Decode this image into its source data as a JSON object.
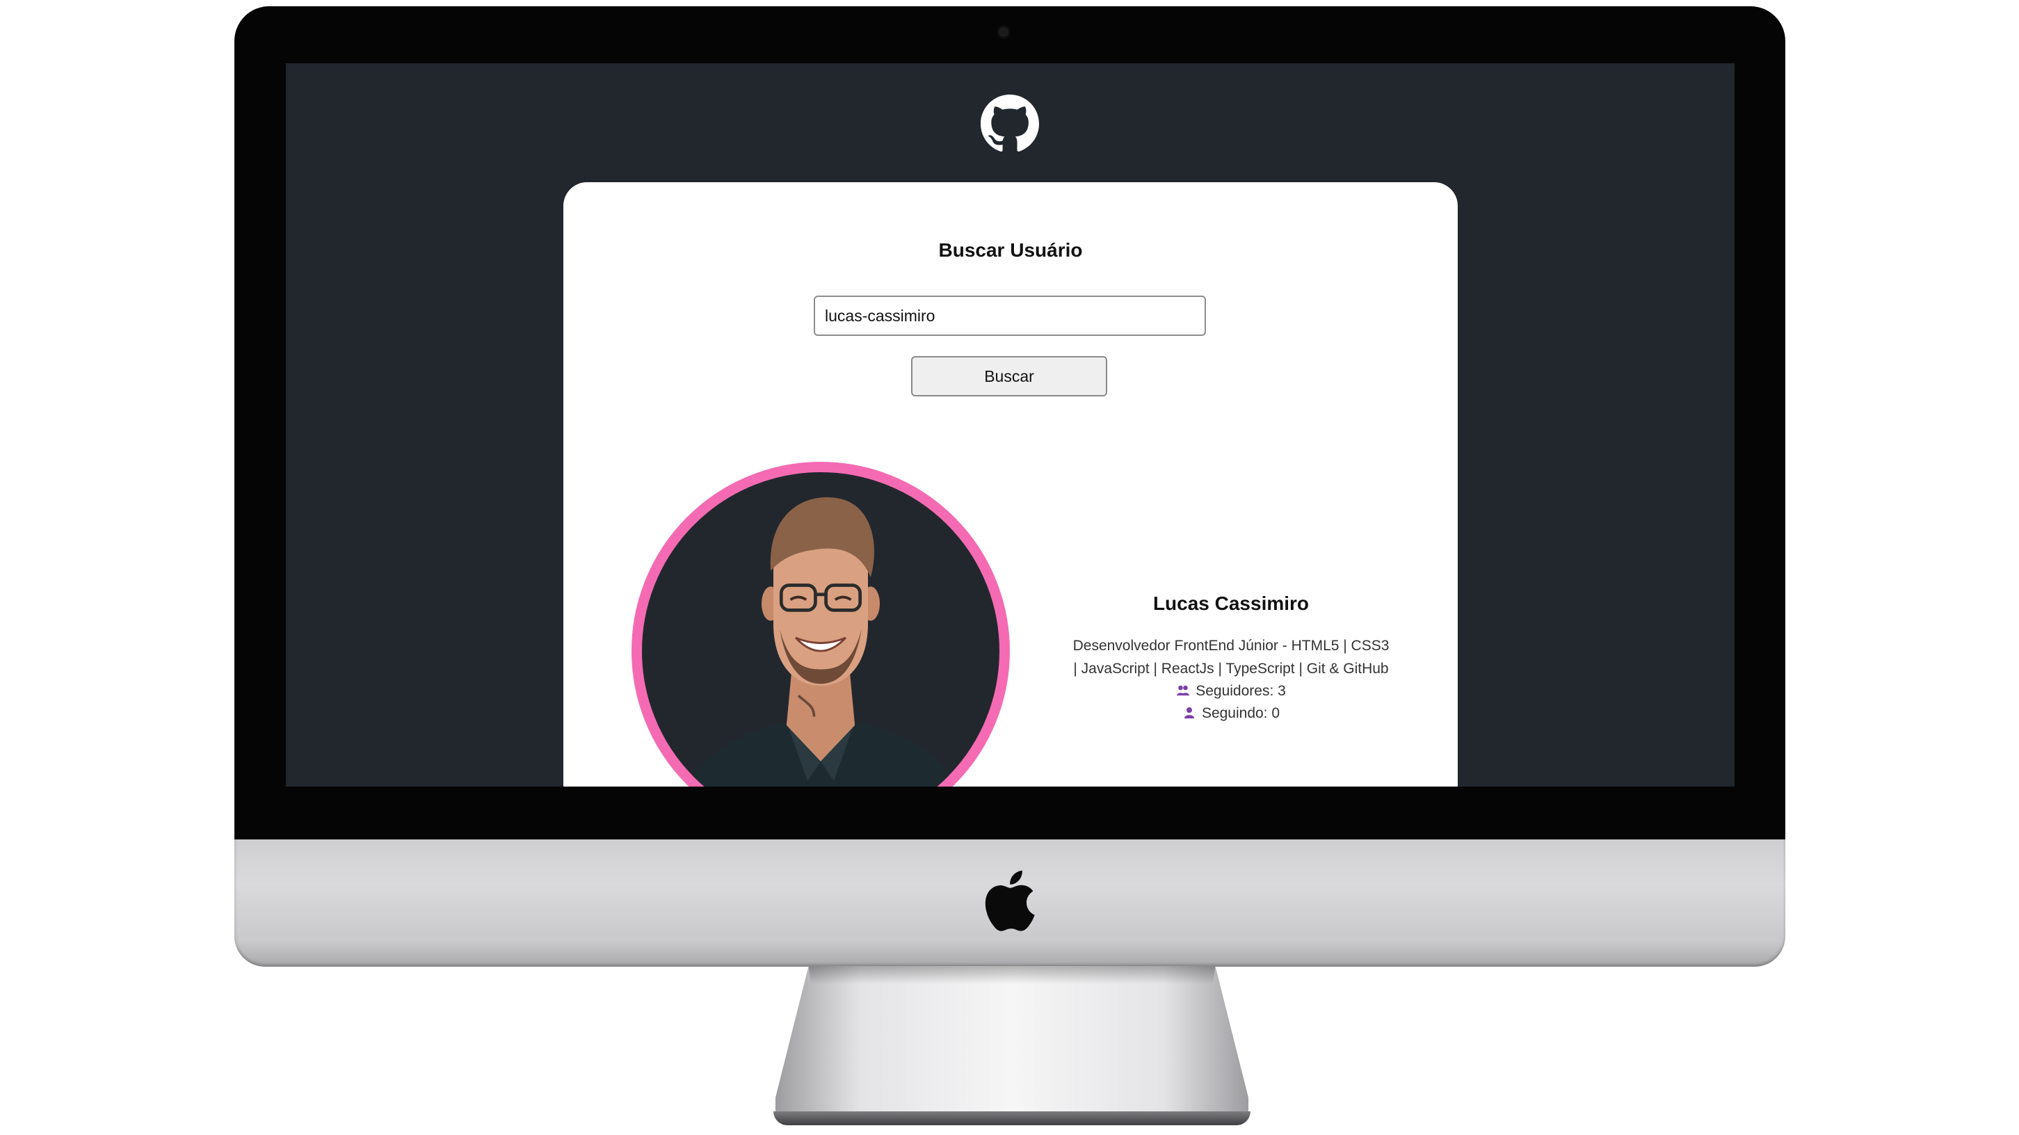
{
  "header": {
    "logo_icon": "github-icon"
  },
  "search": {
    "title": "Buscar Usuário",
    "input_value": "lucas-cassimiro",
    "button_label": "Buscar"
  },
  "profile": {
    "name": "Lucas Cassimiro",
    "bio_line1": "Desenvolvedor FrontEnd Júnior - HTML5 | CSS3",
    "bio_line2": "| JavaScript | ReactJs | TypeScript | Git & GitHub",
    "followers": "Seguidores: 3",
    "following": "Seguindo: 0",
    "followers_icon": "users-icon",
    "following_icon": "user-icon",
    "avatar_ring_color": "#f46bb3",
    "stat_icon_color": "#7a3fa8"
  },
  "colors": {
    "screen_background": "#22272e",
    "card_background": "#ffffff"
  },
  "device": {
    "logo_icon": "apple-logo-icon"
  }
}
